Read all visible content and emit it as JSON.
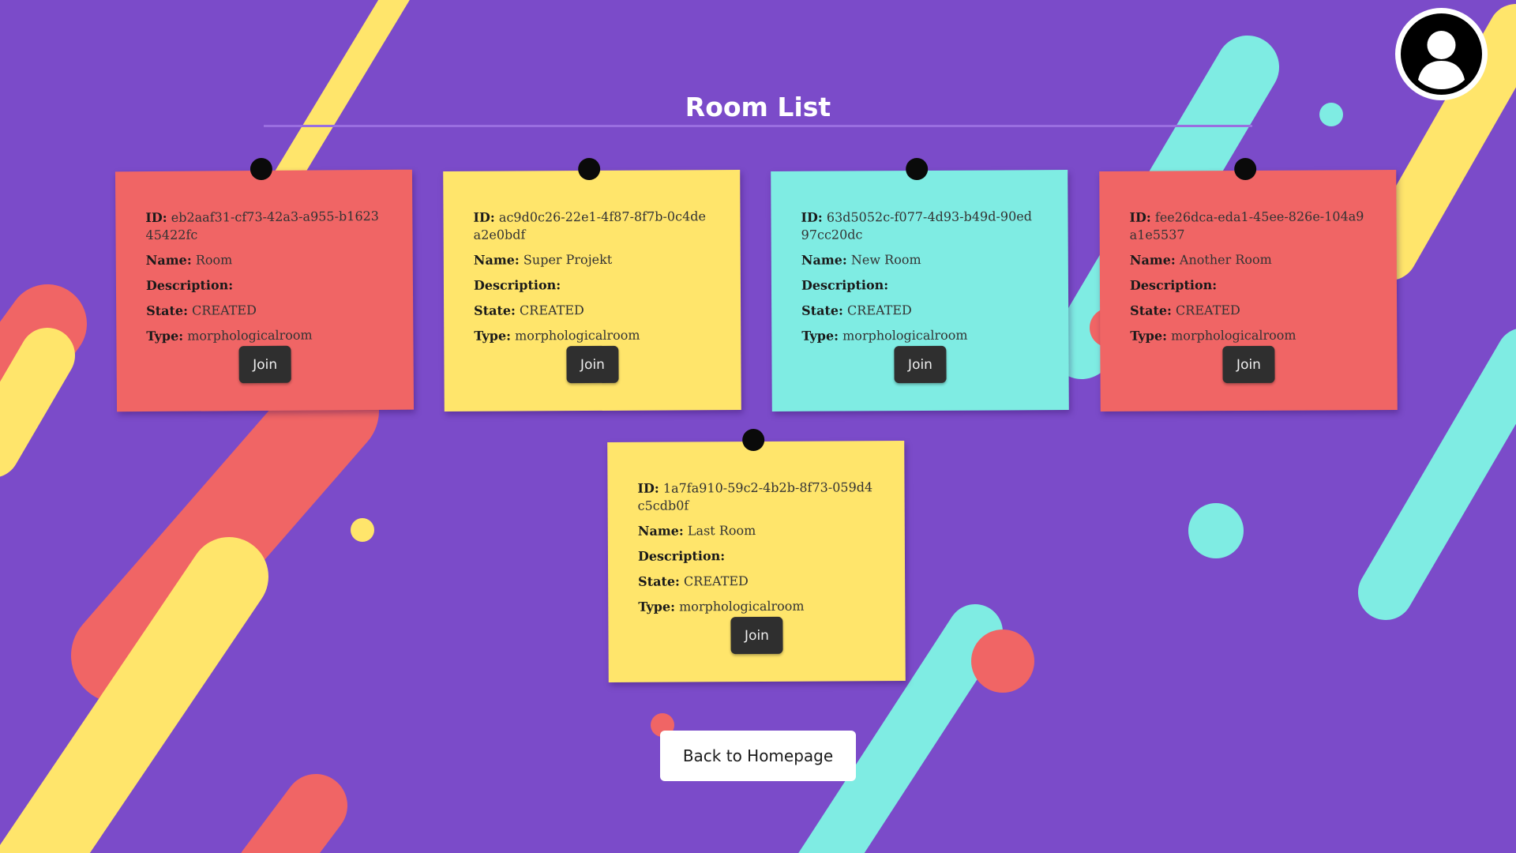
{
  "page": {
    "title": "Room List",
    "back_button_label": "Back to Homepage"
  },
  "labels": {
    "id": "ID:",
    "name": "Name:",
    "description": "Description:",
    "state": "State:",
    "type": "Type:"
  },
  "rooms": [
    {
      "id": "eb2aaf31-cf73-42a3-a955-b162345422fc",
      "name": "Room",
      "description": "",
      "state": "CREATED",
      "type": "morphologicalroom",
      "join_label": "Join",
      "color": "#f06565"
    },
    {
      "id": "ac9d0c26-22e1-4f87-8f7b-0c4dea2e0bdf",
      "name": "Super Projekt",
      "description": "",
      "state": "CREATED",
      "type": "morphologicalroom",
      "join_label": "Join",
      "color": "#ffe56b"
    },
    {
      "id": "63d5052c-f077-4d93-b49d-90ed97cc20dc",
      "name": "New Room",
      "description": "",
      "state": "CREATED",
      "type": "morphologicalroom",
      "join_label": "Join",
      "color": "#7fece3"
    },
    {
      "id": "fee26dca-eda1-45ee-826e-104a9a1e5537",
      "name": "Another Room",
      "description": "",
      "state": "CREATED",
      "type": "morphologicalroom",
      "join_label": "Join",
      "color": "#f06565"
    },
    {
      "id": "1a7fa910-59c2-4b2b-8f73-059d4c5cdb0f",
      "name": "Last Room",
      "description": "",
      "state": "CREATED",
      "type": "morphologicalroom",
      "join_label": "Join",
      "color": "#ffe56b"
    }
  ],
  "icons": {
    "profile": "user-avatar-icon"
  },
  "colors": {
    "background": "#7b4bc9",
    "coral": "#f06565",
    "yellow": "#ffe56b",
    "cyan": "#7fece3",
    "button_dark": "#2f2f2f"
  }
}
